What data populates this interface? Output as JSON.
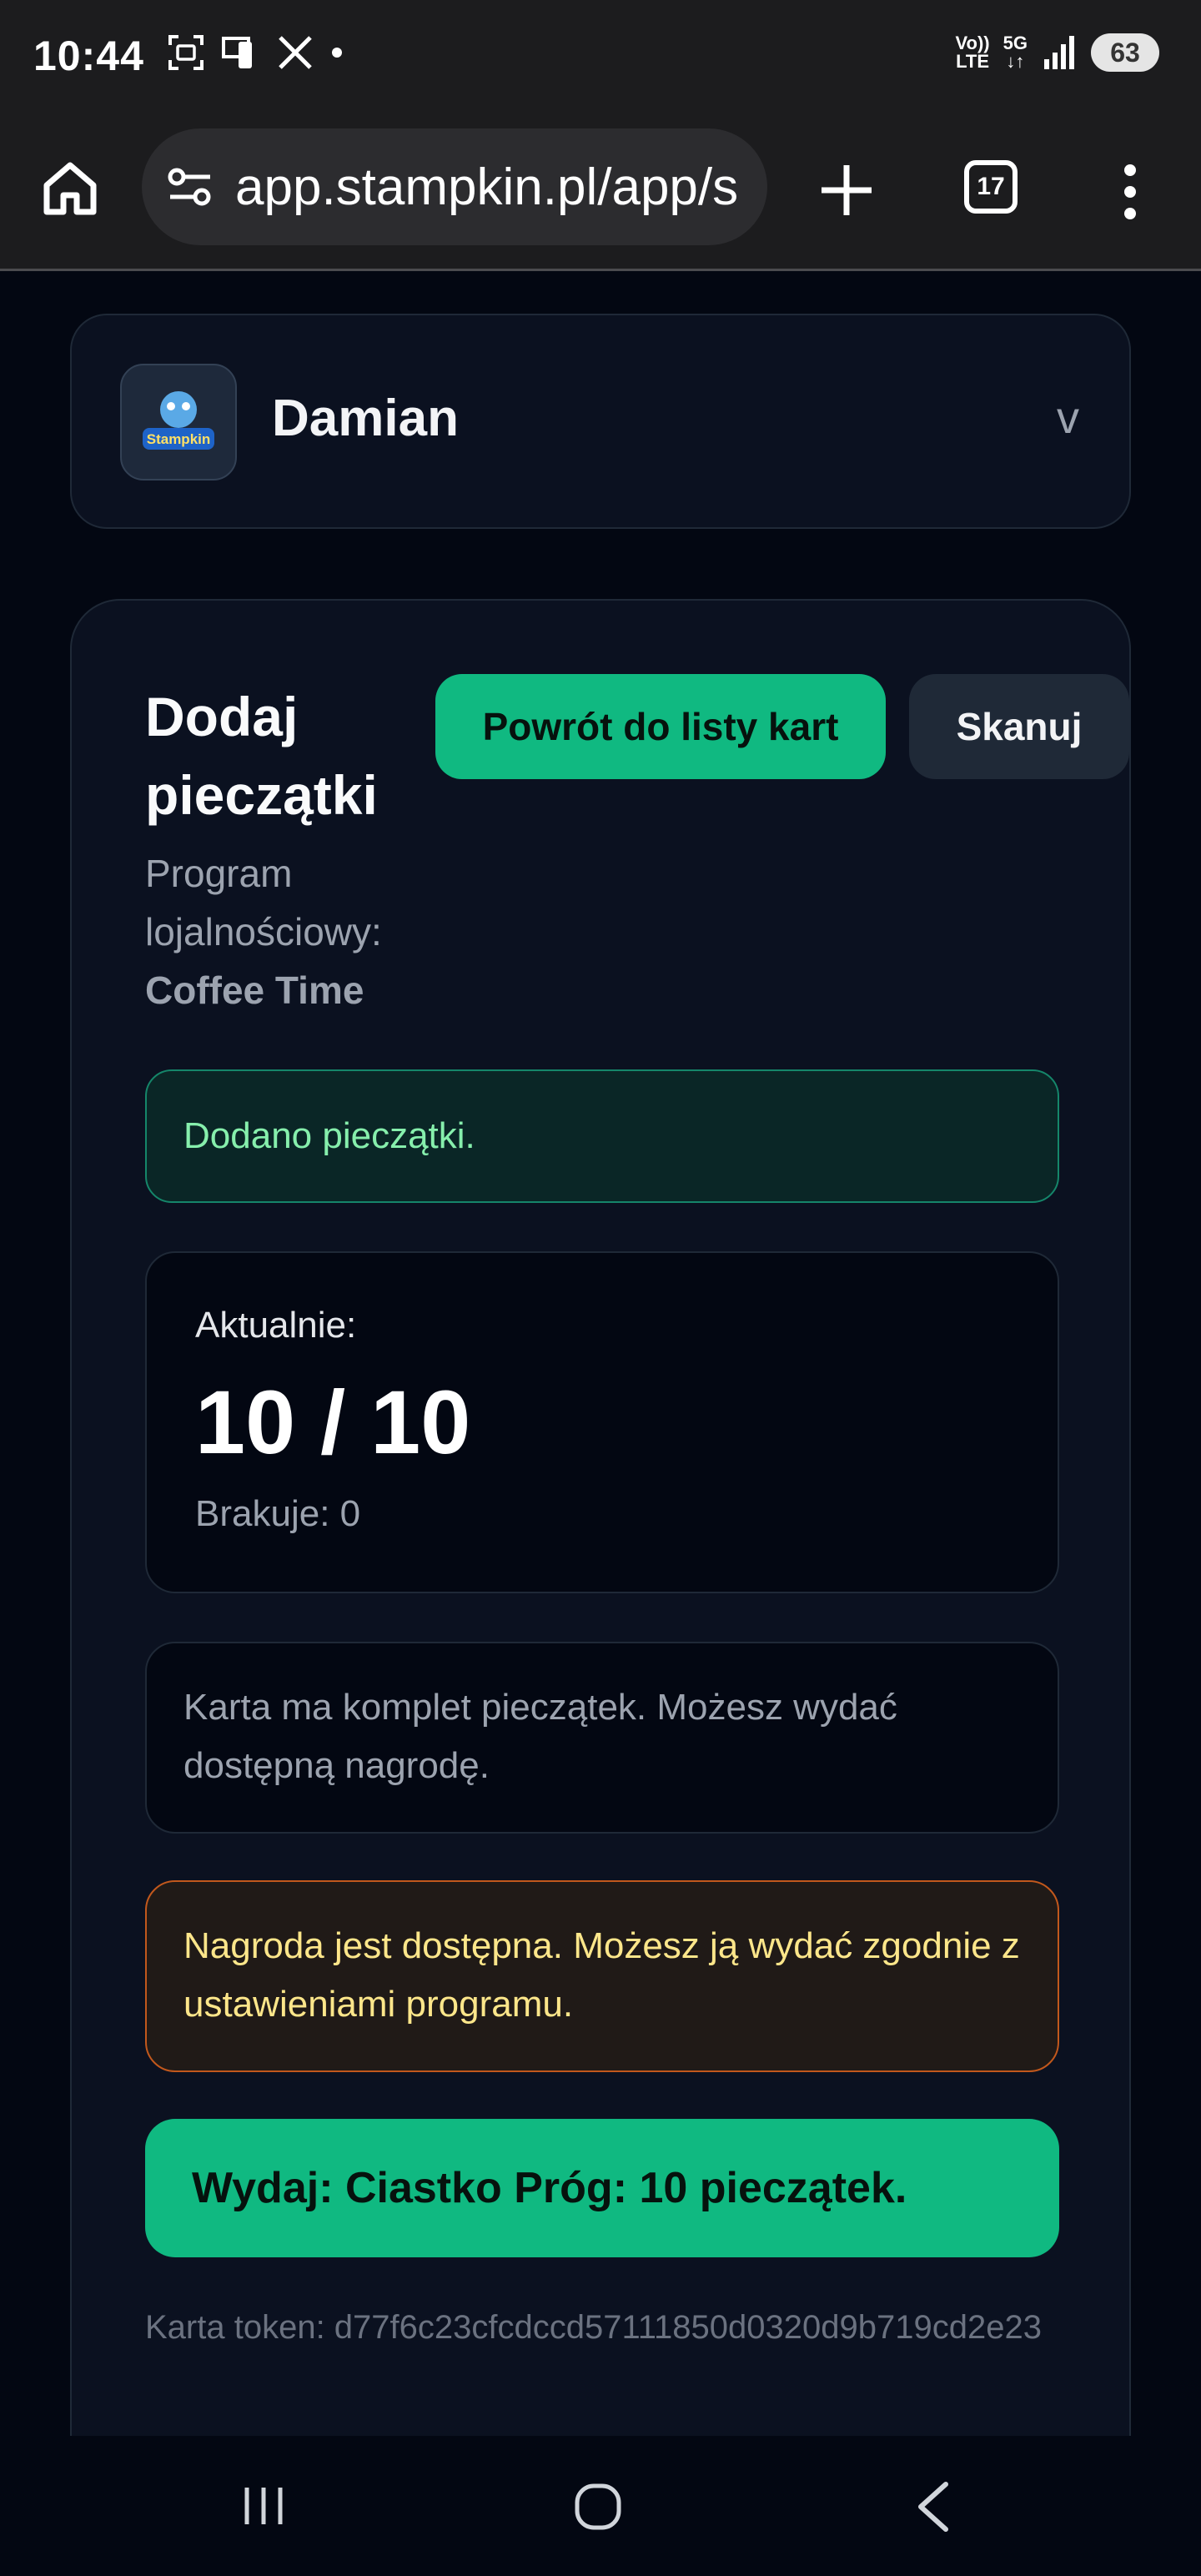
{
  "status_bar": {
    "time": "10:44",
    "left_icons": [
      "screenshot-icon",
      "device-icon",
      "x-icon",
      "dot-icon"
    ],
    "volte_top": "Vo))",
    "volte_bottom": "LTE",
    "network": "5G",
    "battery": "63"
  },
  "browser": {
    "url": "app.stampkin.pl/app/s",
    "tab_count": "17"
  },
  "profile": {
    "name": "Damian",
    "logo_text": "Stampkin",
    "chevron": "v"
  },
  "main": {
    "title": "Dodaj pieczątki",
    "back_button": "Powrót do listy kart",
    "scan_button": "Skanuj",
    "program_label": "Program lojalnościowy:",
    "program_name": "Coffee Time",
    "success_message": "Dodano pieczątki.",
    "counter_label": "Aktualnie:",
    "counter_value": "10 / 10",
    "missing": "Brakuje: 0",
    "info_message": "Karta ma komplet pieczątek. Możesz wydać dostępną nagrodę.",
    "warning_message": "Nagroda jest dostępna. Możesz ją wydać zgodnie z ustawieniami programu.",
    "redeem_button": "Wydaj: Ciastko Próg: 10 pieczątek.",
    "token": "Karta token: d77f6c23cfcdccd57111850d0320d9b719cd2e23"
  },
  "colors": {
    "accent": "#10b981",
    "background": "#030712",
    "card": "#0b1120",
    "warning_border": "#c2581c",
    "success_border": "#15866a"
  }
}
